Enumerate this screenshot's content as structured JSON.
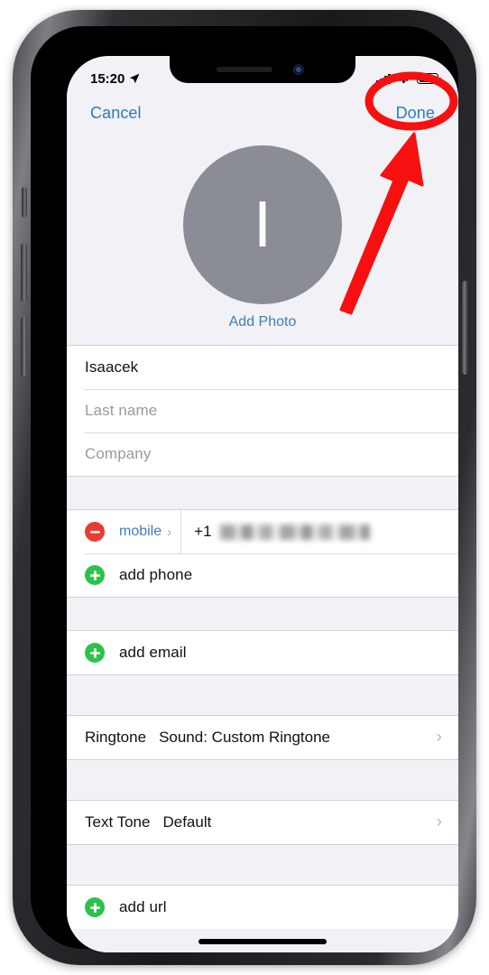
{
  "status_bar": {
    "time": "15:20",
    "location_icon": "location-arrow-icon",
    "signal_icon": "cellular-bars-icon",
    "wifi_icon": "wifi-icon",
    "battery_icon": "battery-full-icon"
  },
  "nav": {
    "cancel_label": "Cancel",
    "done_label": "Done"
  },
  "photo": {
    "initial": "I",
    "add_photo_label": "Add Photo"
  },
  "name_fields": [
    {
      "value": "Isaacek",
      "is_placeholder": false
    },
    {
      "value": "Last name",
      "is_placeholder": true
    },
    {
      "value": "Company",
      "is_placeholder": true
    }
  ],
  "phone_section": {
    "entry": {
      "delete_icon": "minus-circle-icon",
      "label": "mobile",
      "chevron": "›",
      "country_code": "+1",
      "number_redacted": true
    },
    "add_label": "add phone",
    "add_icon": "plus-circle-icon"
  },
  "email_section": {
    "add_label": "add email",
    "add_icon": "plus-circle-icon"
  },
  "ringtone_row": {
    "label": "Ringtone",
    "value": "Sound: Custom Ringtone",
    "chevron": "›"
  },
  "texttone_row": {
    "label": "Text Tone",
    "value": "Default",
    "chevron": "›"
  },
  "url_section": {
    "add_label": "add url",
    "add_icon": "plus-circle-icon"
  },
  "annotations": {
    "highlight_color": "#f71010",
    "ellipse_target": "done-button",
    "arrow": "arrow-pointing-to-done-button"
  },
  "colors": {
    "accent_blue": "#2b7bc4",
    "link_blue": "#3b7fbc",
    "green": "#2cc24a",
    "red": "#eb3b30",
    "avatar_gray": "#8b8d96",
    "group_bg": "#f2f2f6",
    "row_bg": "#ffffff"
  }
}
